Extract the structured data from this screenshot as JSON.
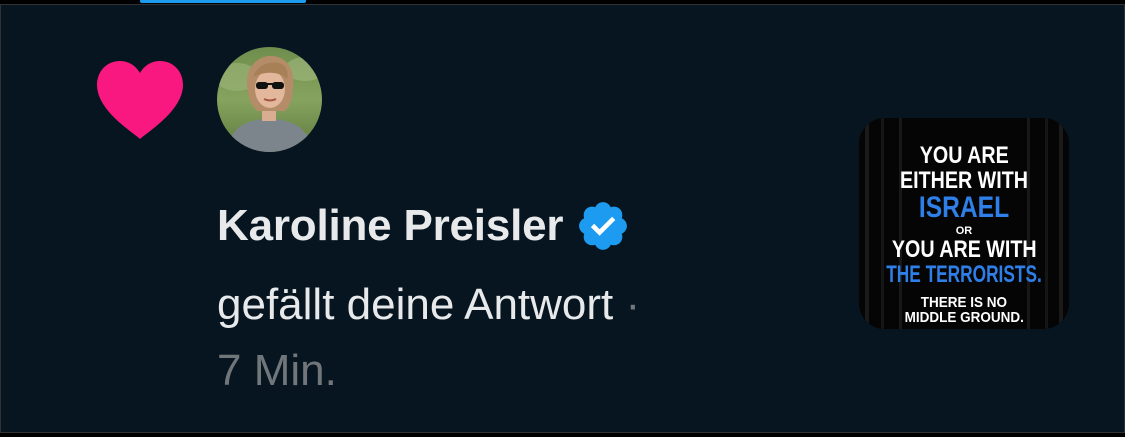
{
  "notification": {
    "type_icon": "heart-icon",
    "avatar_icon": "avatar",
    "user_name": "Karoline Preisler",
    "verified_icon": "verified-badge-icon",
    "action_text": "gefällt deine Antwort",
    "separator": "·",
    "time": "7 Min."
  },
  "thumbnail": {
    "line1": "YOU ARE",
    "line2": "EITHER WITH",
    "line3": "ISRAEL",
    "line4": "OR",
    "line5": "YOU ARE WITH",
    "line6": "THE TERRORISTS.",
    "line7": "THERE IS NO",
    "line8": "MIDDLE GROUND."
  },
  "colors": {
    "background": "#061520",
    "heart": "#f91880",
    "verified": "#1d9bf0",
    "primary_text": "#e7e9ea",
    "secondary_text": "#71767b",
    "accent_text": "#2e7fe8"
  }
}
